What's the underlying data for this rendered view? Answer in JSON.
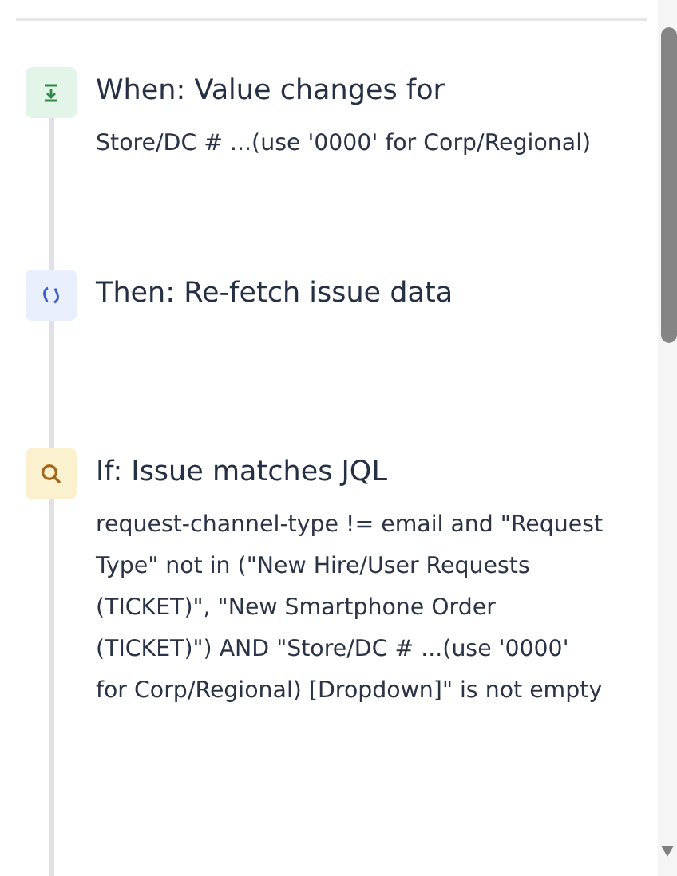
{
  "steps": [
    {
      "kind": "trigger",
      "title": "When: Value changes for",
      "description": "Store/DC # ...(use '0000' for Corp/Regional)"
    },
    {
      "kind": "action",
      "title": "Then: Re-fetch issue data"
    },
    {
      "kind": "condition",
      "title": "If: Issue matches JQL",
      "description": "request-channel-type != email and \"Request Type\" not in (\"New Hire/User Requests (TICKET)\", \"New Smartphone Order (TICKET)\") AND \"Store/DC # ...(use '0000' for Corp/Regional) [Dropdown]\" is not empty"
    }
  ]
}
